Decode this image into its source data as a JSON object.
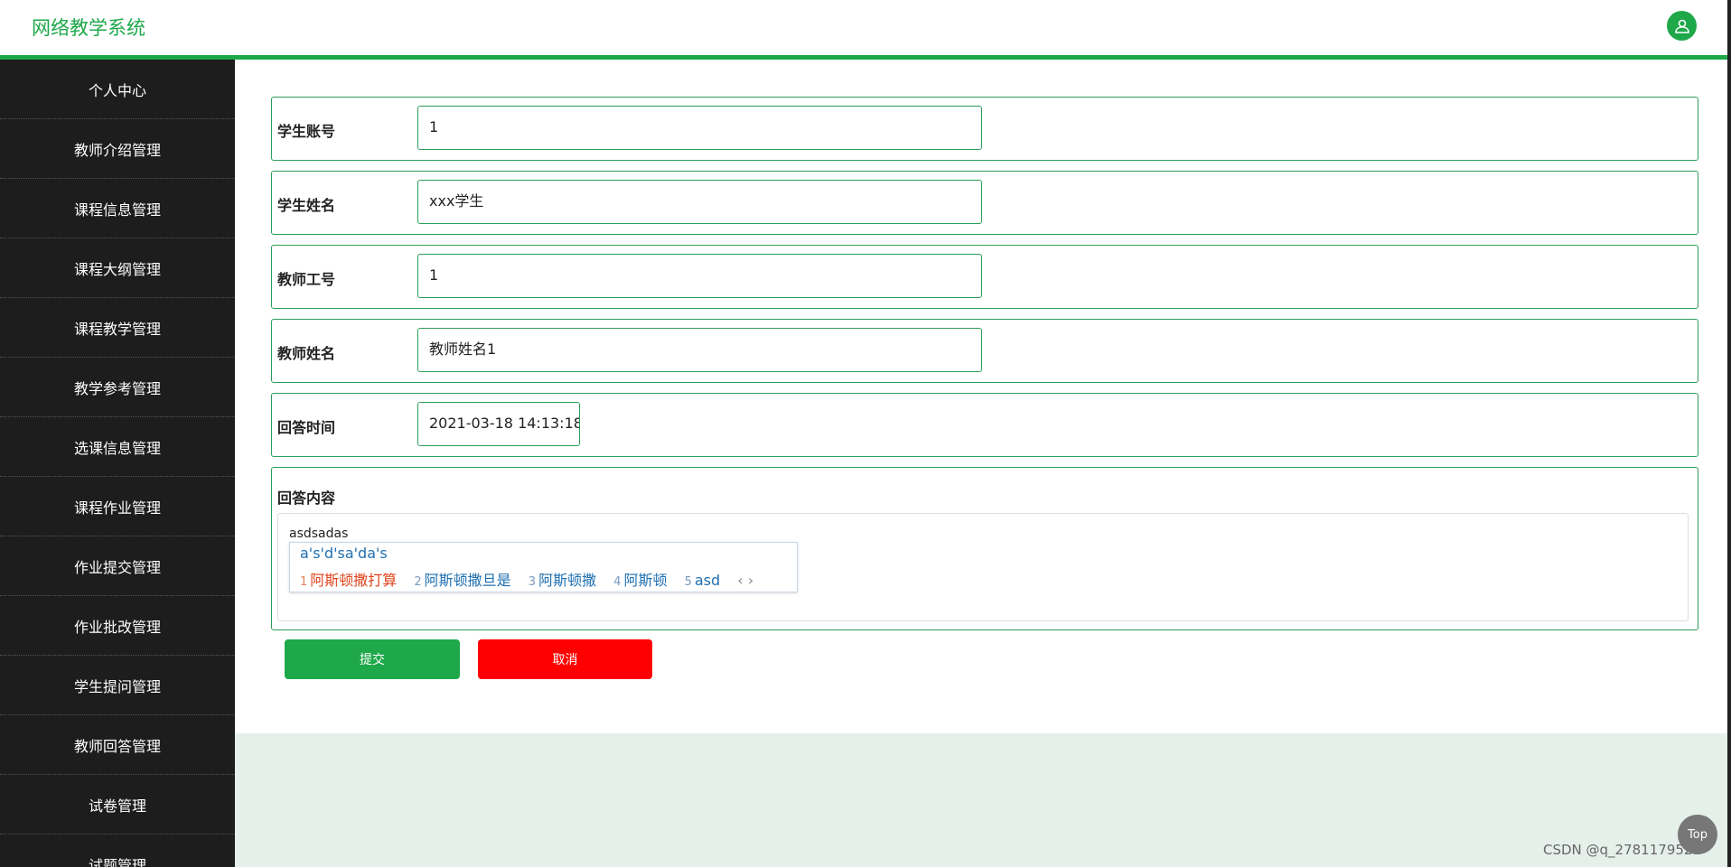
{
  "header": {
    "title": "网络教学系统",
    "avatar_icon": "user-icon"
  },
  "sidebar": {
    "items": [
      "个人中心",
      "教师介绍管理",
      "课程信息管理",
      "课程大纲管理",
      "课程教学管理",
      "教学参考管理",
      "选课信息管理",
      "课程作业管理",
      "作业提交管理",
      "作业批改管理",
      "学生提问管理",
      "教师回答管理",
      "试卷管理",
      "试题管理"
    ]
  },
  "form": {
    "fields": [
      {
        "label": "学生账号",
        "value": "1"
      },
      {
        "label": "学生姓名",
        "value": "xxx学生"
      },
      {
        "label": "教师工号",
        "value": "1"
      },
      {
        "label": "教师姓名",
        "value": "教师姓名1"
      },
      {
        "label": "回答时间",
        "value": "2021-03-18 14:13:18"
      }
    ],
    "content_label": "回答内容",
    "content_value": "asdsadas",
    "submit": "提交",
    "cancel": "取消"
  },
  "ime": {
    "pinyin": "a's'd'sa'da's",
    "candidates": [
      {
        "n": "1",
        "t": "阿斯顿撒打算"
      },
      {
        "n": "2",
        "t": "阿斯顿撒旦是"
      },
      {
        "n": "3",
        "t": "阿斯顿撒"
      },
      {
        "n": "4",
        "t": "阿斯顿"
      },
      {
        "n": "5",
        "t": "asd"
      }
    ],
    "nav": "‹ ›"
  },
  "top_button": "Top",
  "watermark": "CSDN @q_2781179521",
  "colors": {
    "accent": "#1ea84a",
    "cancel": "#ff0000",
    "sidebar": "#1d1d1d"
  }
}
